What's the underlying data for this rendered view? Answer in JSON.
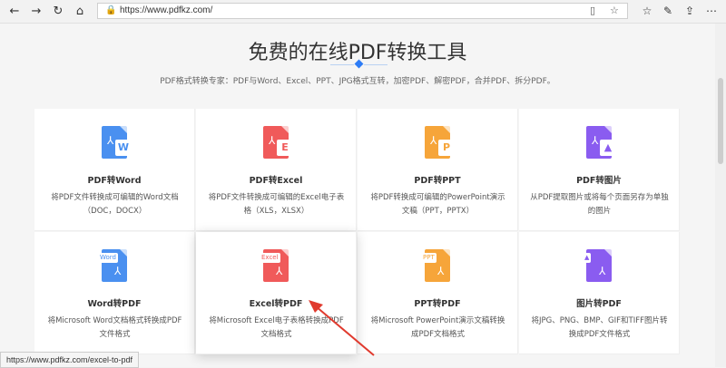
{
  "browser": {
    "url": "https://www.pdfkz.com/",
    "status_url": "https://www.pdfkz.com/excel-to-pdf"
  },
  "hero": {
    "title": "免费的在线PDF转换工具",
    "subtitle": "PDF格式转换专家：PDF与Word、Excel、PPT、JPG格式互转，加密PDF、解密PDF，合并PDF、拆分PDF。"
  },
  "cards": [
    {
      "title": "PDF转Word",
      "desc": "将PDF文件转换成可编辑的Word文档（DOC，DOCX）",
      "icon": "pdf-to-word-icon",
      "color": "#4a90f0",
      "badge": "W"
    },
    {
      "title": "PDF转Excel",
      "desc": "将PDF文件转换成可编辑的Excel电子表格（XLS，XLSX）",
      "icon": "pdf-to-excel-icon",
      "color": "#f05a5a",
      "badge": "E"
    },
    {
      "title": "PDF转PPT",
      "desc": "将PDF转换成可编辑的PowerPoint演示文稿（PPT，PPTX）",
      "icon": "pdf-to-ppt-icon",
      "color": "#f6a53a",
      "badge": "P"
    },
    {
      "title": "PDF转图片",
      "desc": "从PDF提取图片或将每个页面另存为单独的图片",
      "icon": "pdf-to-image-icon",
      "color": "#8a5cf0",
      "badge": "▲"
    },
    {
      "title": "Word转PDF",
      "desc": "将Microsoft Word文档格式转换成PDF文件格式",
      "icon": "word-to-pdf-icon",
      "color": "#4a90f0",
      "tag": "Word"
    },
    {
      "title": "Excel转PDF",
      "desc": "将Microsoft Excel电子表格转换成PDF文档格式",
      "icon": "excel-to-pdf-icon",
      "color": "#f05a5a",
      "tag": "Excel"
    },
    {
      "title": "PPT转PDF",
      "desc": "将Microsoft PowerPoint演示文稿转换成PDF文档格式",
      "icon": "ppt-to-pdf-icon",
      "color": "#f6a53a",
      "tag": "PPT"
    },
    {
      "title": "图片转PDF",
      "desc": "将JPG、PNG、BMP、GIF和TIFF图片转换成PDF文件格式",
      "icon": "image-to-pdf-icon",
      "color": "#8a5cf0",
      "tag": "▲"
    }
  ]
}
